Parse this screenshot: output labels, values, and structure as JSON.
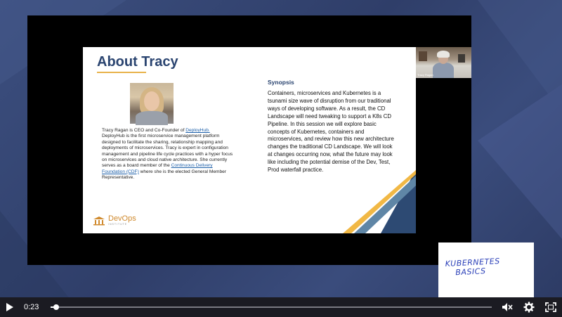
{
  "slide": {
    "title": "About Tracy",
    "bio_1": "Tracy Ragan is CEO and Co-Founder of ",
    "bio_link_1": "DeployHub.",
    "bio_2": "  DeployHub is the first microservice management platform designed to facilitate the sharing, relationship mapping and deployments of microservices. Tracy is expert in configuration management and pipeline life cycle practices with a hyper focus on microservices and cloud native architecture.  She currently serves as a board member of the ",
    "bio_link_2": "Continuous Delivery Foundation (CDF)",
    "bio_3": " where she is the elected General Member Representative.",
    "synopsis_heading": "Synopsis",
    "synopsis_body": "Containers, microservices and Kubernetes is a tsunami size wave of disruption from our traditional ways of developing software.  As a result, the CD Landscape will need tweaking to support a K8s CD Pipeline.  In this session we will explore basic concepts of Kubernetes, containers and microservices, and review how this new architecture changes the traditional CD Landscape.  We will look at changes occurring now, what the future may look like including the potential demise of the Dev, Test, Prod waterfall practice.",
    "logo_name": "DevOps",
    "logo_sub": "INSTITUTE"
  },
  "webcam": {
    "name": "Tracy Ragan"
  },
  "card": {
    "line1": "KUBERNETES",
    "line2": "BASICS"
  },
  "player": {
    "time": "0:23",
    "progress": 0.013,
    "icons": [
      "play-icon",
      "volume-mute-icon",
      "gear-icon",
      "fullscreen-icon"
    ]
  },
  "colors": {
    "title": "#2a4470",
    "accent_gold": "#e8b24a",
    "link": "#1b5ea8",
    "card_ink": "#2a3fb8",
    "stripe_navy": "#2d4a73",
    "stripe_blue": "#5f86a6",
    "stripe_gold": "#f1b845"
  }
}
